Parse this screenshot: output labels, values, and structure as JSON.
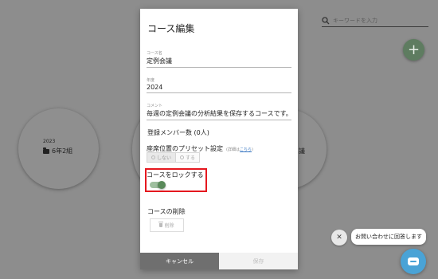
{
  "background": {
    "search_placeholder": "キーワードを入力",
    "add_button": "+",
    "course_year": "2023",
    "course_name": "6年2組",
    "course_partial": "議"
  },
  "modal": {
    "title": "コース編集",
    "course_name_label": "コース名",
    "course_name_value": "定例会議",
    "year_label": "年度",
    "year_value": "2024",
    "comment_label": "コメント",
    "comment_value": "毎週の定例会議の分析結果を保存するコースです。",
    "members_label": "登録メンバー数 (0人)",
    "preset_label": "座席位置のプリセット設定",
    "preset_note_prefix": "(詳細は",
    "preset_note_link": "こちら",
    "preset_note_suffix": ")",
    "preset_options": [
      "しない",
      "する"
    ],
    "lock_label": "コースをロックする",
    "lock_enabled": true,
    "delete_title": "コースの削除",
    "delete_button": "削除",
    "cancel_button": "キャンセル",
    "save_button": "保存"
  },
  "chat": {
    "close": "✕",
    "bubble_text": "お問い合わせに回答します"
  },
  "colors": {
    "accent_green": "#5a8a5a",
    "highlight_red": "#e5181f",
    "chat_blue": "#4aa3d6"
  }
}
